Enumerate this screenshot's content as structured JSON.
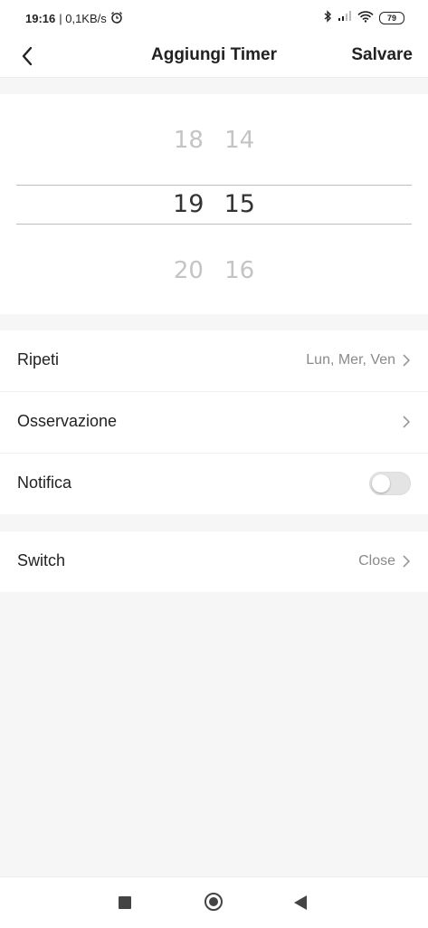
{
  "status_bar": {
    "time": "19:16",
    "network_speed": "| 0,1KB/s",
    "battery": "79",
    "icons": [
      "alarm-icon",
      "bluetooth-icon",
      "signal-icon",
      "wifi-icon",
      "battery-icon"
    ]
  },
  "header": {
    "title": "Aggiungi Timer",
    "save_label": "Salvare"
  },
  "time_picker": {
    "prev": {
      "hour": "18",
      "minute": "14"
    },
    "current": {
      "hour": "19",
      "minute": "15"
    },
    "next": {
      "hour": "20",
      "minute": "16"
    }
  },
  "settings": {
    "repeat": {
      "label": "Ripeti",
      "value": "Lun, Mer, Ven"
    },
    "note": {
      "label": "Osservazione"
    },
    "notification": {
      "label": "Notifica",
      "enabled": false
    }
  },
  "action": {
    "switch": {
      "label": "Switch",
      "value": "Close"
    }
  },
  "colors": {
    "background": "#f6f6f6",
    "surface": "#ffffff",
    "picker_faded": "#c4c4c4"
  }
}
